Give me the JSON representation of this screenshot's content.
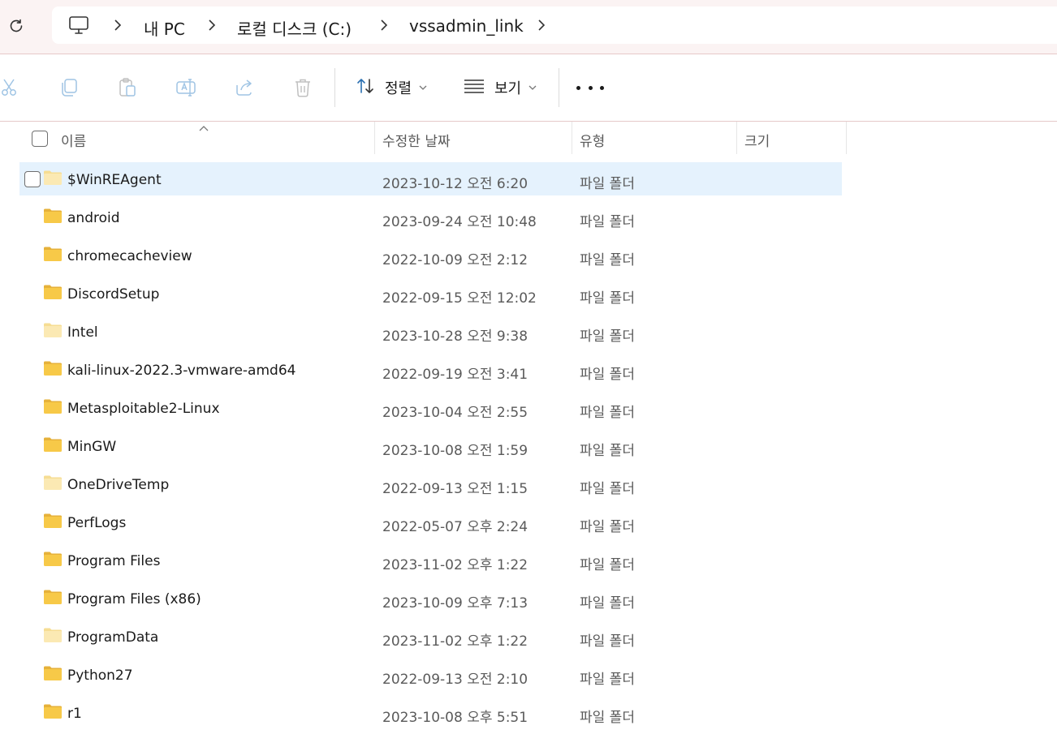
{
  "address_bar": {
    "crumbs": [
      "내 PC",
      "로컬 디스크 (C:)",
      "vssadmin_link"
    ]
  },
  "toolbar": {
    "sort_label": "정렬",
    "view_label": "보기",
    "icons": [
      "cut-icon",
      "copy-icon",
      "paste-icon",
      "rename-icon",
      "share-icon",
      "delete-icon"
    ]
  },
  "columns": {
    "name": "이름",
    "modified": "수정한 날짜",
    "type": "유형",
    "size": "크기"
  },
  "files": [
    {
      "name": "$WinREAgent",
      "date": "2023-10-12 오전 6:20",
      "type": "파일 폴더",
      "hidden": true,
      "selected": true
    },
    {
      "name": "android",
      "date": "2023-09-24 오전 10:48",
      "type": "파일 폴더",
      "hidden": false
    },
    {
      "name": "chromecacheview",
      "date": "2022-10-09 오전 2:12",
      "type": "파일 폴더",
      "hidden": false
    },
    {
      "name": "DiscordSetup",
      "date": "2022-09-15 오전 12:02",
      "type": "파일 폴더",
      "hidden": false
    },
    {
      "name": "Intel",
      "date": "2023-10-28 오전 9:38",
      "type": "파일 폴더",
      "hidden": true
    },
    {
      "name": "kali-linux-2022.3-vmware-amd64",
      "date": "2022-09-19 오전 3:41",
      "type": "파일 폴더",
      "hidden": false
    },
    {
      "name": "Metasploitable2-Linux",
      "date": "2023-10-04 오전 2:55",
      "type": "파일 폴더",
      "hidden": false
    },
    {
      "name": "MinGW",
      "date": "2023-10-08 오전 1:59",
      "type": "파일 폴더",
      "hidden": false
    },
    {
      "name": "OneDriveTemp",
      "date": "2022-09-13 오전 1:15",
      "type": "파일 폴더",
      "hidden": true
    },
    {
      "name": "PerfLogs",
      "date": "2022-05-07 오후 2:24",
      "type": "파일 폴더",
      "hidden": false
    },
    {
      "name": "Program Files",
      "date": "2023-11-02 오후 1:22",
      "type": "파일 폴더",
      "hidden": false
    },
    {
      "name": "Program Files (x86)",
      "date": "2023-10-09 오후 7:13",
      "type": "파일 폴더",
      "hidden": false
    },
    {
      "name": "ProgramData",
      "date": "2023-11-02 오후 1:22",
      "type": "파일 폴더",
      "hidden": true
    },
    {
      "name": "Python27",
      "date": "2022-09-13 오전 2:10",
      "type": "파일 폴더",
      "hidden": false
    },
    {
      "name": "r1",
      "date": "2023-10-08 오후 5:51",
      "type": "파일 폴더",
      "hidden": false
    }
  ]
}
